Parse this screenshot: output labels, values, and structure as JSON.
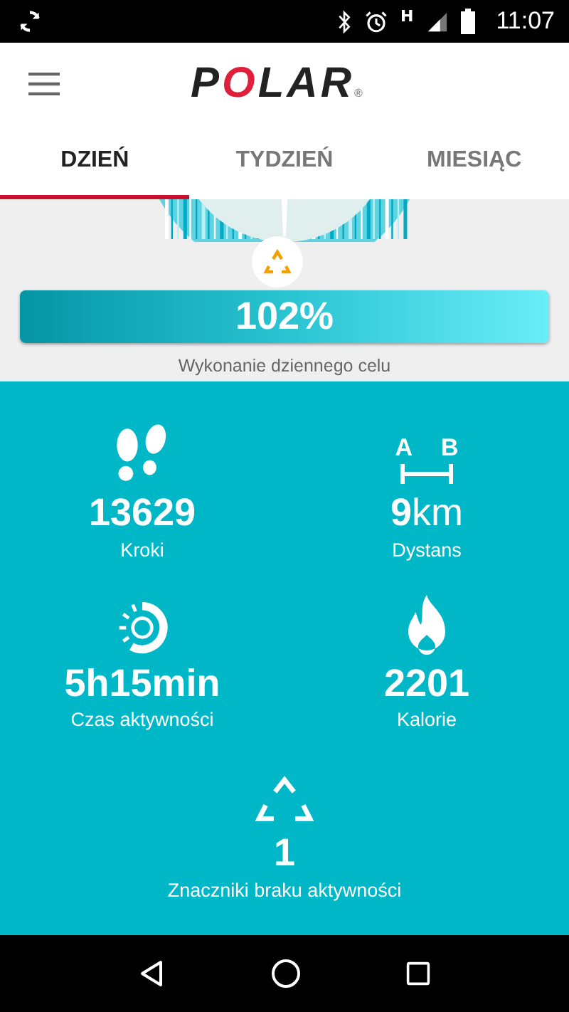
{
  "status_bar": {
    "network": "H",
    "time": "11:07"
  },
  "logo": {
    "text": "POLAR",
    "mark": "®"
  },
  "tabs": [
    {
      "label": "DZIEŃ",
      "selected": true
    },
    {
      "label": "TYDZIEŃ",
      "selected": false
    },
    {
      "label": "MIESIĄC",
      "selected": false
    }
  ],
  "goal": {
    "level": 1.0,
    "percent": "102%",
    "caption": "Wykonanie dziennego celu"
  },
  "stats": [
    {
      "kind": "steps",
      "value": "13629",
      "label": "Kroki"
    },
    {
      "kind": "distance",
      "value": "9",
      "unit": "km",
      "label": "Dystans",
      "icon_text": [
        "A",
        "B"
      ]
    },
    {
      "kind": "activity",
      "value": "5h15min",
      "label": "Czas aktywności"
    },
    {
      "kind": "calories",
      "value": "2201",
      "label": "Kalorie"
    },
    {
      "kind": "inactivity",
      "value": "1",
      "label": "Znaczniki braku aktywności"
    }
  ]
}
